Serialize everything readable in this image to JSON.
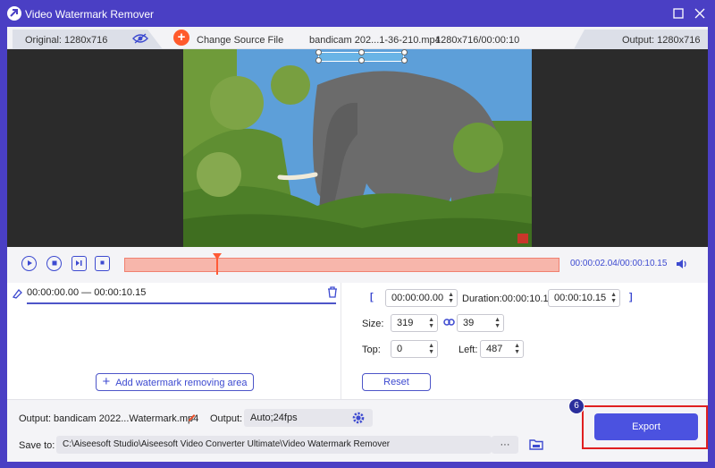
{
  "window": {
    "title": "Video Watermark Remover"
  },
  "topbar": {
    "original": "Original: 1280x716",
    "change_source": "Change Source File",
    "file_name": "bandicam 202...1-36-210.mp4",
    "file_info": "1280x716/00:00:10",
    "output": "Output: 1280x716"
  },
  "player": {
    "current": "00:00:02.04",
    "total": "/00:00:10.15",
    "playhead_fraction": 0.21
  },
  "watermark_area": {
    "range": "00:00:00.00 — 00:00:10.15",
    "add_label": "Add watermark removing area"
  },
  "clip": {
    "bracket_left": "[",
    "start": "00:00:00.00",
    "duration": "Duration:00:00:10.15",
    "end": "00:00:10.15",
    "bracket_right": "]"
  },
  "size": {
    "label": "Size:",
    "width": "319",
    "height": "39"
  },
  "position": {
    "top_label": "Top:",
    "top": "0",
    "left_label": "Left:",
    "left": "487"
  },
  "reset_label": "Reset",
  "output": {
    "label": "Output:",
    "file": "bandicam 2022...Watermark.mp4",
    "format_label": "Output:",
    "format": "Auto;24fps"
  },
  "save": {
    "label": "Save to:",
    "path": "C:\\Aiseesoft Studio\\Aiseesoft Video Converter Ultimate\\Video Watermark Remover",
    "more": "···"
  },
  "export_label": "Export",
  "step_badge": "6"
}
